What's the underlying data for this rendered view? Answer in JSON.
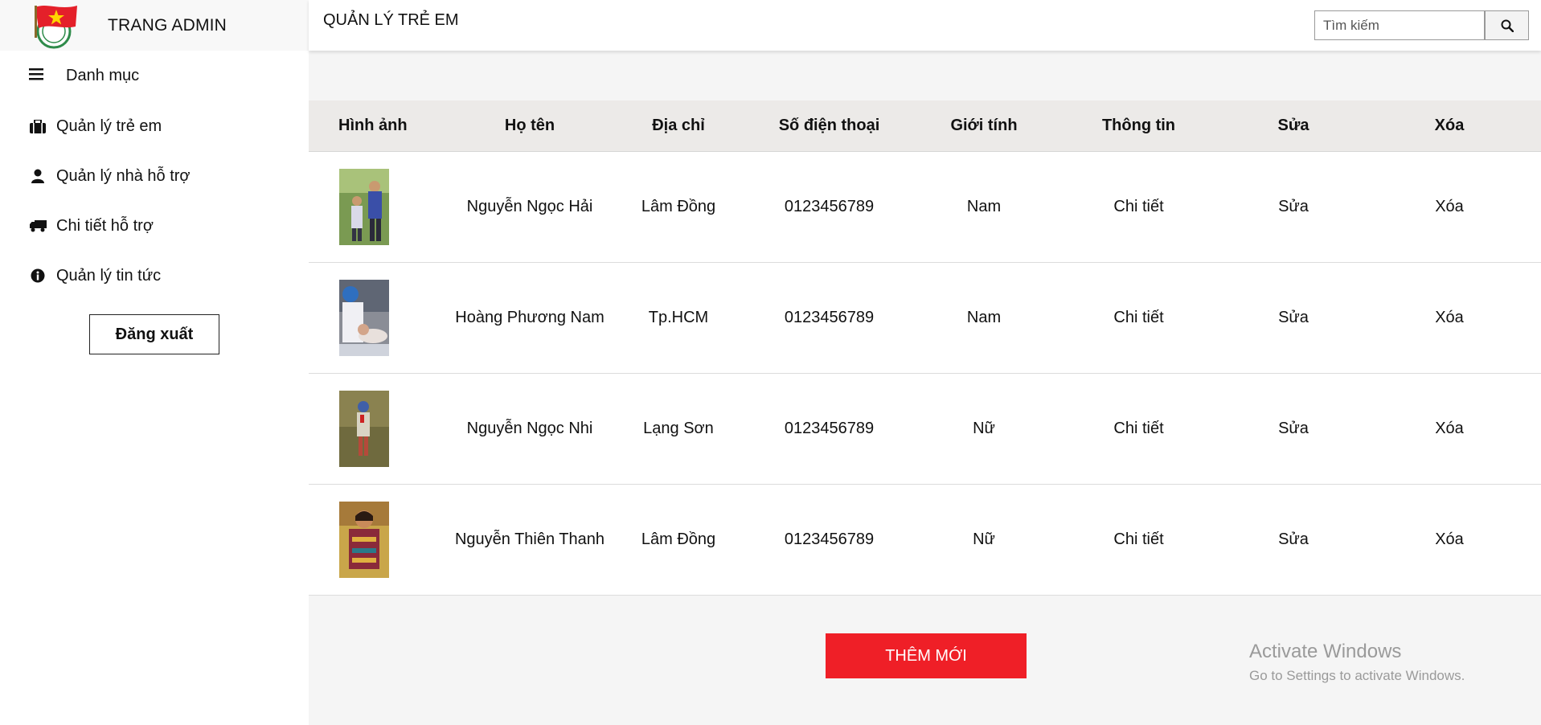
{
  "sidebar": {
    "brand_title": "TRANG ADMIN",
    "menu_header": "Danh mục",
    "items": [
      {
        "label": "Quản lý trẻ em",
        "icon": "briefcase-icon"
      },
      {
        "label": "Quản lý nhà hỗ trợ",
        "icon": "user-icon"
      },
      {
        "label": "Chi tiết hỗ trợ",
        "icon": "truck-icon"
      },
      {
        "label": "Quản lý tin tức",
        "icon": "info-icon"
      }
    ],
    "logout_label": "Đăng xuất"
  },
  "header": {
    "title": "QUẢN LÝ TRẺ EM",
    "search_placeholder": "Tìm kiếm"
  },
  "table": {
    "columns": [
      "Hình ảnh",
      "Họ tên",
      "Địa chỉ",
      "Số điện thoại",
      "Giới tính",
      "Thông tin",
      "Sửa",
      "Xóa"
    ],
    "rows": [
      {
        "name": "Nguyễn Ngọc Hải",
        "address": "Lâm Đồng",
        "phone": "0123456789",
        "gender": "Nam",
        "info": "Chi tiết",
        "edit": "Sửa",
        "delete": "Xóa"
      },
      {
        "name": "Hoàng Phương Nam",
        "address": "Tp.HCM",
        "phone": "0123456789",
        "gender": "Nam",
        "info": "Chi tiết",
        "edit": "Sửa",
        "delete": "Xóa"
      },
      {
        "name": "Nguyễn Ngọc Nhi",
        "address": "Lạng Sơn",
        "phone": "0123456789",
        "gender": "Nữ",
        "info": "Chi tiết",
        "edit": "Sửa",
        "delete": "Xóa"
      },
      {
        "name": "Nguyễn Thiên Thanh",
        "address": "Lâm Đồng",
        "phone": "0123456789",
        "gender": "Nữ",
        "info": "Chi tiết",
        "edit": "Sửa",
        "delete": "Xóa"
      }
    ]
  },
  "actions": {
    "add_label": "THÊM MỚI"
  },
  "watermark": {
    "title": "Activate Windows",
    "subtitle": "Go to Settings to activate Windows."
  },
  "colors": {
    "accent_red": "#ef1f27",
    "header_row_bg": "#eceae8",
    "main_bg": "#f5f5f5"
  }
}
